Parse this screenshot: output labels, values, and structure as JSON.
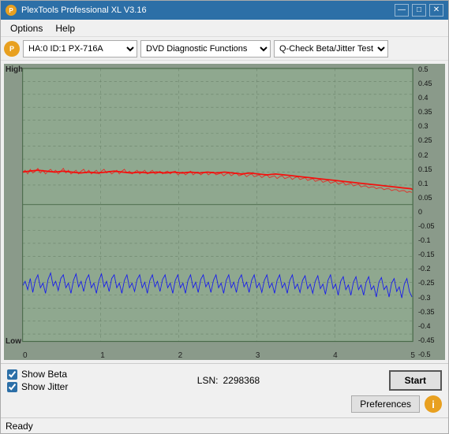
{
  "window": {
    "title": "PlexTools Professional XL V3.16",
    "icon": "P"
  },
  "titlebar": {
    "minimize": "—",
    "maximize": "□",
    "close": "✕"
  },
  "menu": {
    "items": [
      "Options",
      "Help"
    ]
  },
  "toolbar": {
    "drive_icon": "P",
    "drive_label": "HA:0  ID:1  PX-716A",
    "function_label": "DVD Diagnostic Functions",
    "test_label": "Q-Check Beta/Jitter Test"
  },
  "chart": {
    "label_high": "High",
    "label_low": "Low",
    "y_labels": [
      "0.5",
      "0.45",
      "0.4",
      "0.35",
      "0.3",
      "0.25",
      "0.2",
      "0.15",
      "0.1",
      "0.05",
      "0",
      "-0.05",
      "-0.1",
      "-0.15",
      "-0.2",
      "-0.25",
      "-0.3",
      "-0.35",
      "-0.4",
      "-0.45",
      "-0.5"
    ],
    "x_labels": [
      "0",
      "1",
      "2",
      "3",
      "4",
      "5"
    ]
  },
  "controls": {
    "show_beta_label": "Show Beta",
    "show_beta_checked": true,
    "show_jitter_label": "Show Jitter",
    "show_jitter_checked": true,
    "lsn_label": "LSN:",
    "lsn_value": "2298368",
    "start_label": "Start",
    "preferences_label": "Preferences",
    "info_icon": "i"
  },
  "status": {
    "text": "Ready"
  }
}
